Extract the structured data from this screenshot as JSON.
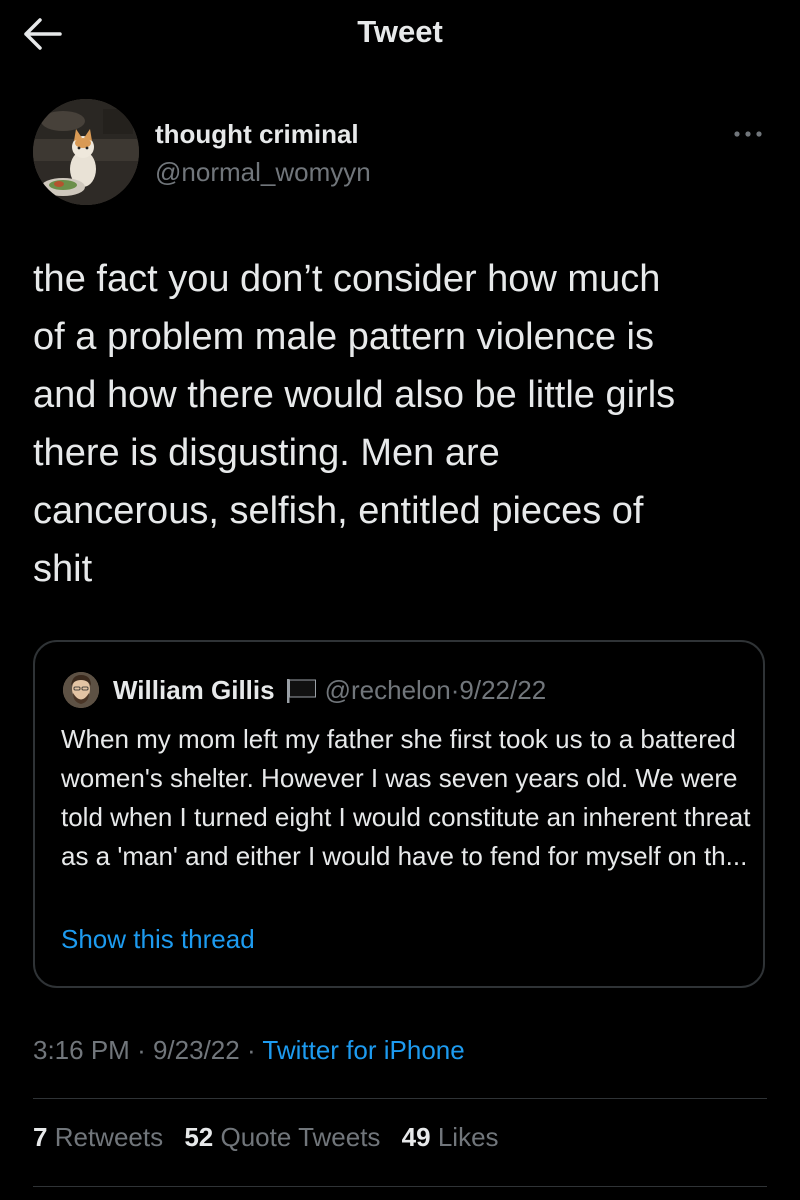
{
  "header": {
    "title": "Tweet",
    "back_icon": "arrow-left-icon"
  },
  "author": {
    "name": "thought criminal",
    "handle": "@normal_womyyn",
    "avatar_icon": "cat-avatar",
    "more_icon": "more-horizontal-icon"
  },
  "tweet": {
    "text": "the fact you don’t consider how much\nof a problem male pattern violence is\nand how there would also be little girls\nthere is disgusting. Men are\ncancerous, selfish, entitled pieces of\nshit"
  },
  "quote": {
    "name": "William Gillis",
    "flag_icon": "black-flag-emoji",
    "handle": "@rechelon",
    "separator": "·",
    "date": "9/22/22",
    "text": "When my mom left my father she first took us to a battered women's shelter. However I was seven years old. We were told when I turned eight I would constitute an inherent threat as a 'man' and either I would have to fend for myself on th...",
    "show_thread": "Show this thread"
  },
  "meta": {
    "time": "3:16 PM",
    "sep1": "·",
    "date": "9/23/22",
    "sep2": "·",
    "source": "Twitter for iPhone"
  },
  "stats": {
    "retweets_count": "7",
    "retweets_label": "Retweets",
    "quotes_count": "52",
    "quotes_label": "Quote Tweets",
    "likes_count": "49",
    "likes_label": "Likes"
  },
  "colors": {
    "background": "#000000",
    "text": "#e7e9ea",
    "secondary": "#71767b",
    "link": "#1d9bf0",
    "border": "#2f3336"
  }
}
